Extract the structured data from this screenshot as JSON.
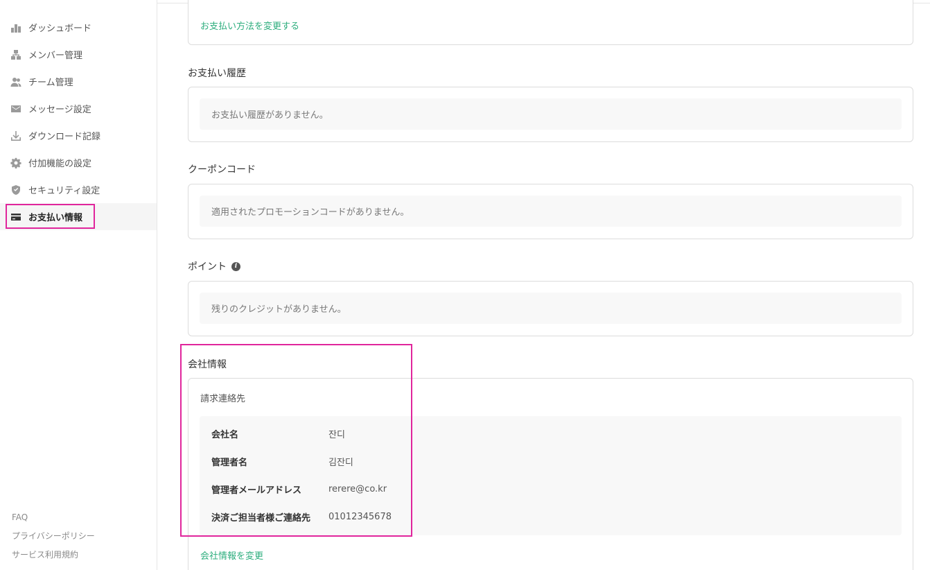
{
  "sidebar": {
    "items": [
      {
        "label": "ダッシュボード",
        "icon": "bar-chart-icon"
      },
      {
        "label": "メンバー管理",
        "icon": "org-chart-icon"
      },
      {
        "label": "チーム管理",
        "icon": "team-icon"
      },
      {
        "label": "メッセージ設定",
        "icon": "mail-icon"
      },
      {
        "label": "ダウンロード記録",
        "icon": "download-icon"
      },
      {
        "label": "付加機能の設定",
        "icon": "gear-icon"
      },
      {
        "label": "セキュリティ設定",
        "icon": "shield-icon"
      },
      {
        "label": "お支払い情報",
        "icon": "credit-card-icon",
        "active": true
      }
    ],
    "footer": [
      "FAQ",
      "プライバシーポリシー",
      "サービス利用規約"
    ]
  },
  "payment_method": {
    "change_link": "お支払い方法を変更する"
  },
  "payment_history": {
    "title": "お支払い履歴",
    "empty": "お支払い履歴がありません。"
  },
  "coupon": {
    "title": "クーポンコード",
    "empty": "適用されたプロモーションコードがありません。"
  },
  "points": {
    "title": "ポイント",
    "info_icon": "i",
    "empty": "残りのクレジットがありません。"
  },
  "company": {
    "title": "会社情報",
    "subtitle": "請求連絡先",
    "rows": [
      {
        "key": "会社名",
        "value": "잔디"
      },
      {
        "key": "管理者名",
        "value": "김잔디"
      },
      {
        "key": "管理者メールアドレス",
        "value": "rerere@co.kr"
      },
      {
        "key": "決済ご担当者様ご連絡先",
        "value": "01012345678"
      }
    ],
    "change_link": "会社情報を変更"
  },
  "colors": {
    "accent_link": "#2eae7e",
    "highlight": "#e0259c"
  }
}
